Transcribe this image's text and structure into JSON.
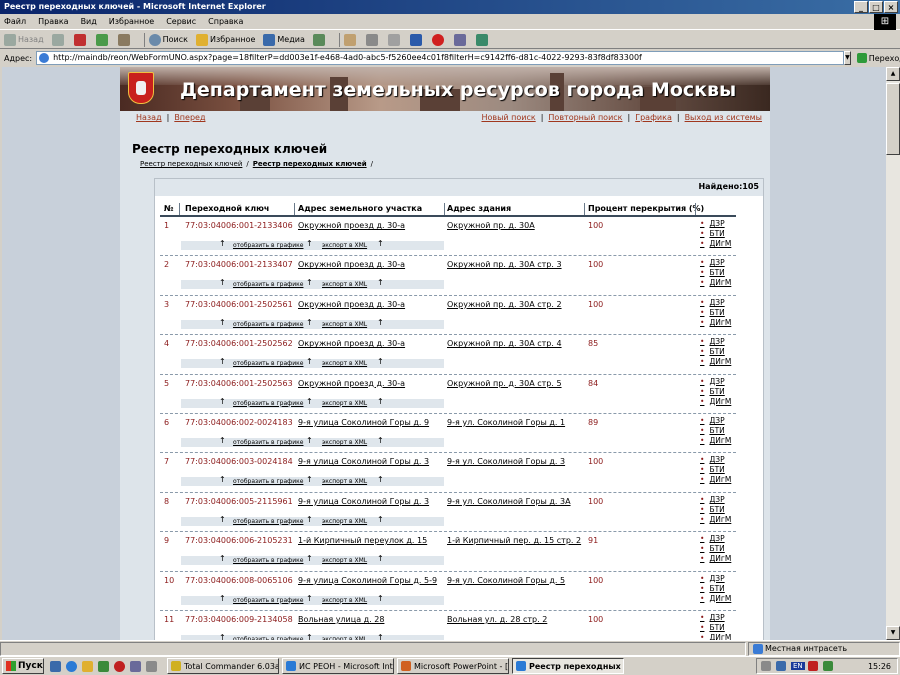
{
  "window": {
    "title": "Реестр переходных ключей - Microsoft Internet Explorer"
  },
  "menu": [
    "Файл",
    "Правка",
    "Вид",
    "Избранное",
    "Сервис",
    "Справка"
  ],
  "toolbar": {
    "back": "Назад",
    "search": "Поиск",
    "favorites": "Избранное",
    "media": "Медиа"
  },
  "address": {
    "label": "Адрес:",
    "url": "http://maindb/reon/WebFormUNO.aspx?page=18filterP=dd003e1f-e468-4ad0-abc5-f5260ee4c01f8filterH=c9142ff6-d81c-4022-9293-83f8df83300f",
    "go": "Переход"
  },
  "banner": {
    "title": "Департамент земельных ресурсов города Москвы"
  },
  "topnav": {
    "back": "Назад",
    "forward": "Вперед",
    "new_search": "Новый поиск",
    "repeat_search": "Повторный поиск",
    "graphics": "Графика",
    "logout": "Выход из системы",
    "sep": "|"
  },
  "page": {
    "title": "Реестр переходных ключей",
    "breadcrumb": [
      "Реестр переходных ключей",
      "Реестр переходных ключей"
    ],
    "crumb_sep": "/",
    "found": "Найдено:105"
  },
  "table": {
    "headers": [
      "№",
      "Переходной ключ",
      "Адрес земельного участка",
      "Адрес здания",
      "Процент перекрытия (%)"
    ],
    "sub_links": {
      "graph": "отобразить в графике",
      "xml": "экспорт в XML",
      "arrow": "↑"
    },
    "link_labels": [
      "ДЗР",
      "БТИ",
      "ДИгМ"
    ],
    "rows": [
      {
        "num": "1",
        "key": "77:03:04006:001-2133406",
        "land": "Окружной проезд д. 30-а",
        "building": "Окружной пр. д. 30А",
        "pct": "100"
      },
      {
        "num": "2",
        "key": "77:03:04006:001-2133407",
        "land": "Окружной проезд д. 30-а",
        "building": "Окружной пр. д. 30А стр. 3",
        "pct": "100"
      },
      {
        "num": "3",
        "key": "77:03:04006:001-2502561",
        "land": "Окружной проезд д. 30-а",
        "building": "Окружной пр. д. 30А стр. 2",
        "pct": "100"
      },
      {
        "num": "4",
        "key": "77:03:04006:001-2502562",
        "land": "Окружной проезд д. 30-а",
        "building": "Окружной пр. д. 30А стр. 4",
        "pct": "85"
      },
      {
        "num": "5",
        "key": "77:03:04006:001-2502563",
        "land": "Окружной проезд д. 30-а",
        "building": "Окружной пр. д. 30А стр. 5",
        "pct": "84"
      },
      {
        "num": "6",
        "key": "77:03:04006:002-0024183",
        "land": "9-я улица Соколиной Горы д. 9",
        "building": "9-я ул. Соколиной Горы д. 1",
        "pct": "89"
      },
      {
        "num": "7",
        "key": "77:03:04006:003-0024184",
        "land": "9-я улица Соколиной Горы д. 3",
        "building": "9-я ул. Соколиной Горы д. 3",
        "pct": "100"
      },
      {
        "num": "8",
        "key": "77:03:04006:005-2115961",
        "land": "9-я улица Соколиной Горы д. 3",
        "building": "9-я ул. Соколиной Горы д. 3А",
        "pct": "100"
      },
      {
        "num": "9",
        "key": "77:03:04006:006-2105231",
        "land": "1-й Кирпичный переулок д. 15",
        "building": "1-й Кирпичный пер. д. 15 стр. 2",
        "pct": "91"
      },
      {
        "num": "10",
        "key": "77:03:04006:008-0065106",
        "land": "9-я улица Соколиной Горы д. 5-9",
        "building": "9-я ул. Соколиной Горы д. 5",
        "pct": "100"
      },
      {
        "num": "11",
        "key": "77:03:04006:009-2134058",
        "land": "Вольная улица д. 28",
        "building": "Вольная ул. д. 28 стр. 2",
        "pct": "100"
      }
    ]
  },
  "status": {
    "zone": "Местная интрасеть"
  },
  "taskbar": {
    "start": "Пуск",
    "tasks": [
      "Total Commander 6.03a - ...",
      "ИС РЕОН - Microsoft Inte...",
      "Microsoft PowerPoint - [К...",
      "Реестр переходных ..."
    ],
    "lang": "EN",
    "time": "15:26"
  },
  "colors": {
    "title_bar": "#0a246a",
    "link": "#a0371e",
    "data_red": "#8b1a1a",
    "page_bg": "#dde4ea"
  }
}
